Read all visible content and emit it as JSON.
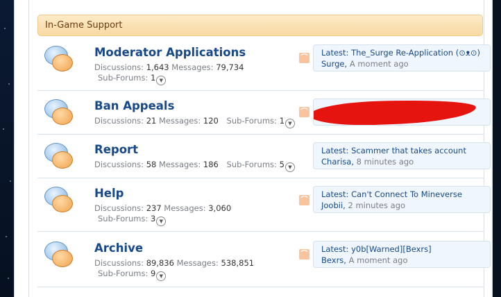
{
  "category": {
    "title": "In-Game Support"
  },
  "nodes": [
    {
      "title": "Moderator Applications",
      "discussions_label": "Discussions:",
      "discussions": "1,643",
      "messages_label": "Messages:",
      "messages": "79,734",
      "subforums_label": "Sub-Forums:",
      "subforums": "1",
      "latest_label": "Latest:",
      "latest_title": "The_Surge Re-Application (⊙ᴥ⊙)",
      "latest_user": "Surge,",
      "latest_time": "A moment ago"
    },
    {
      "title": "Ban Appeals",
      "discussions_label": "Discussions:",
      "discussions": "21",
      "messages_label": "Messages:",
      "messages": "120",
      "subforums_label": "Sub-Forums:",
      "subforums": "1"
    },
    {
      "title": "Report",
      "discussions_label": "Discussions:",
      "discussions": "58",
      "messages_label": "Messages:",
      "messages": "186",
      "subforums_label": "Sub-Forums:",
      "subforums": "5",
      "latest_label": "Latest:",
      "latest_title": "Scammer that takes account",
      "latest_user": "Charisa,",
      "latest_time": "8 minutes ago"
    },
    {
      "title": "Help",
      "discussions_label": "Discussions:",
      "discussions": "237",
      "messages_label": "Messages:",
      "messages": "3,060",
      "subforums_label": "Sub-Forums:",
      "subforums": "3",
      "latest_label": "Latest:",
      "latest_title": "Can't Connect To Mineverse",
      "latest_user": "Joobii,",
      "latest_time": "2 minutes ago"
    },
    {
      "title": "Archive",
      "discussions_label": "Discussions:",
      "discussions": "89,836",
      "messages_label": "Messages:",
      "messages": "538,851",
      "subforums_label": "Sub-Forums:",
      "subforums": "9",
      "latest_label": "Latest:",
      "latest_title": "y0b[Warned][Bexrs]",
      "latest_user": "Bexrs,",
      "latest_time": "A moment ago"
    }
  ],
  "icons": {
    "forum": "speech-bubbles-icon",
    "rss": "rss-icon",
    "expand": "chevron-down-icon"
  },
  "colors": {
    "link": "#17498a",
    "header_bg": "#f8d9a2",
    "redaction": "#e5140f"
  }
}
